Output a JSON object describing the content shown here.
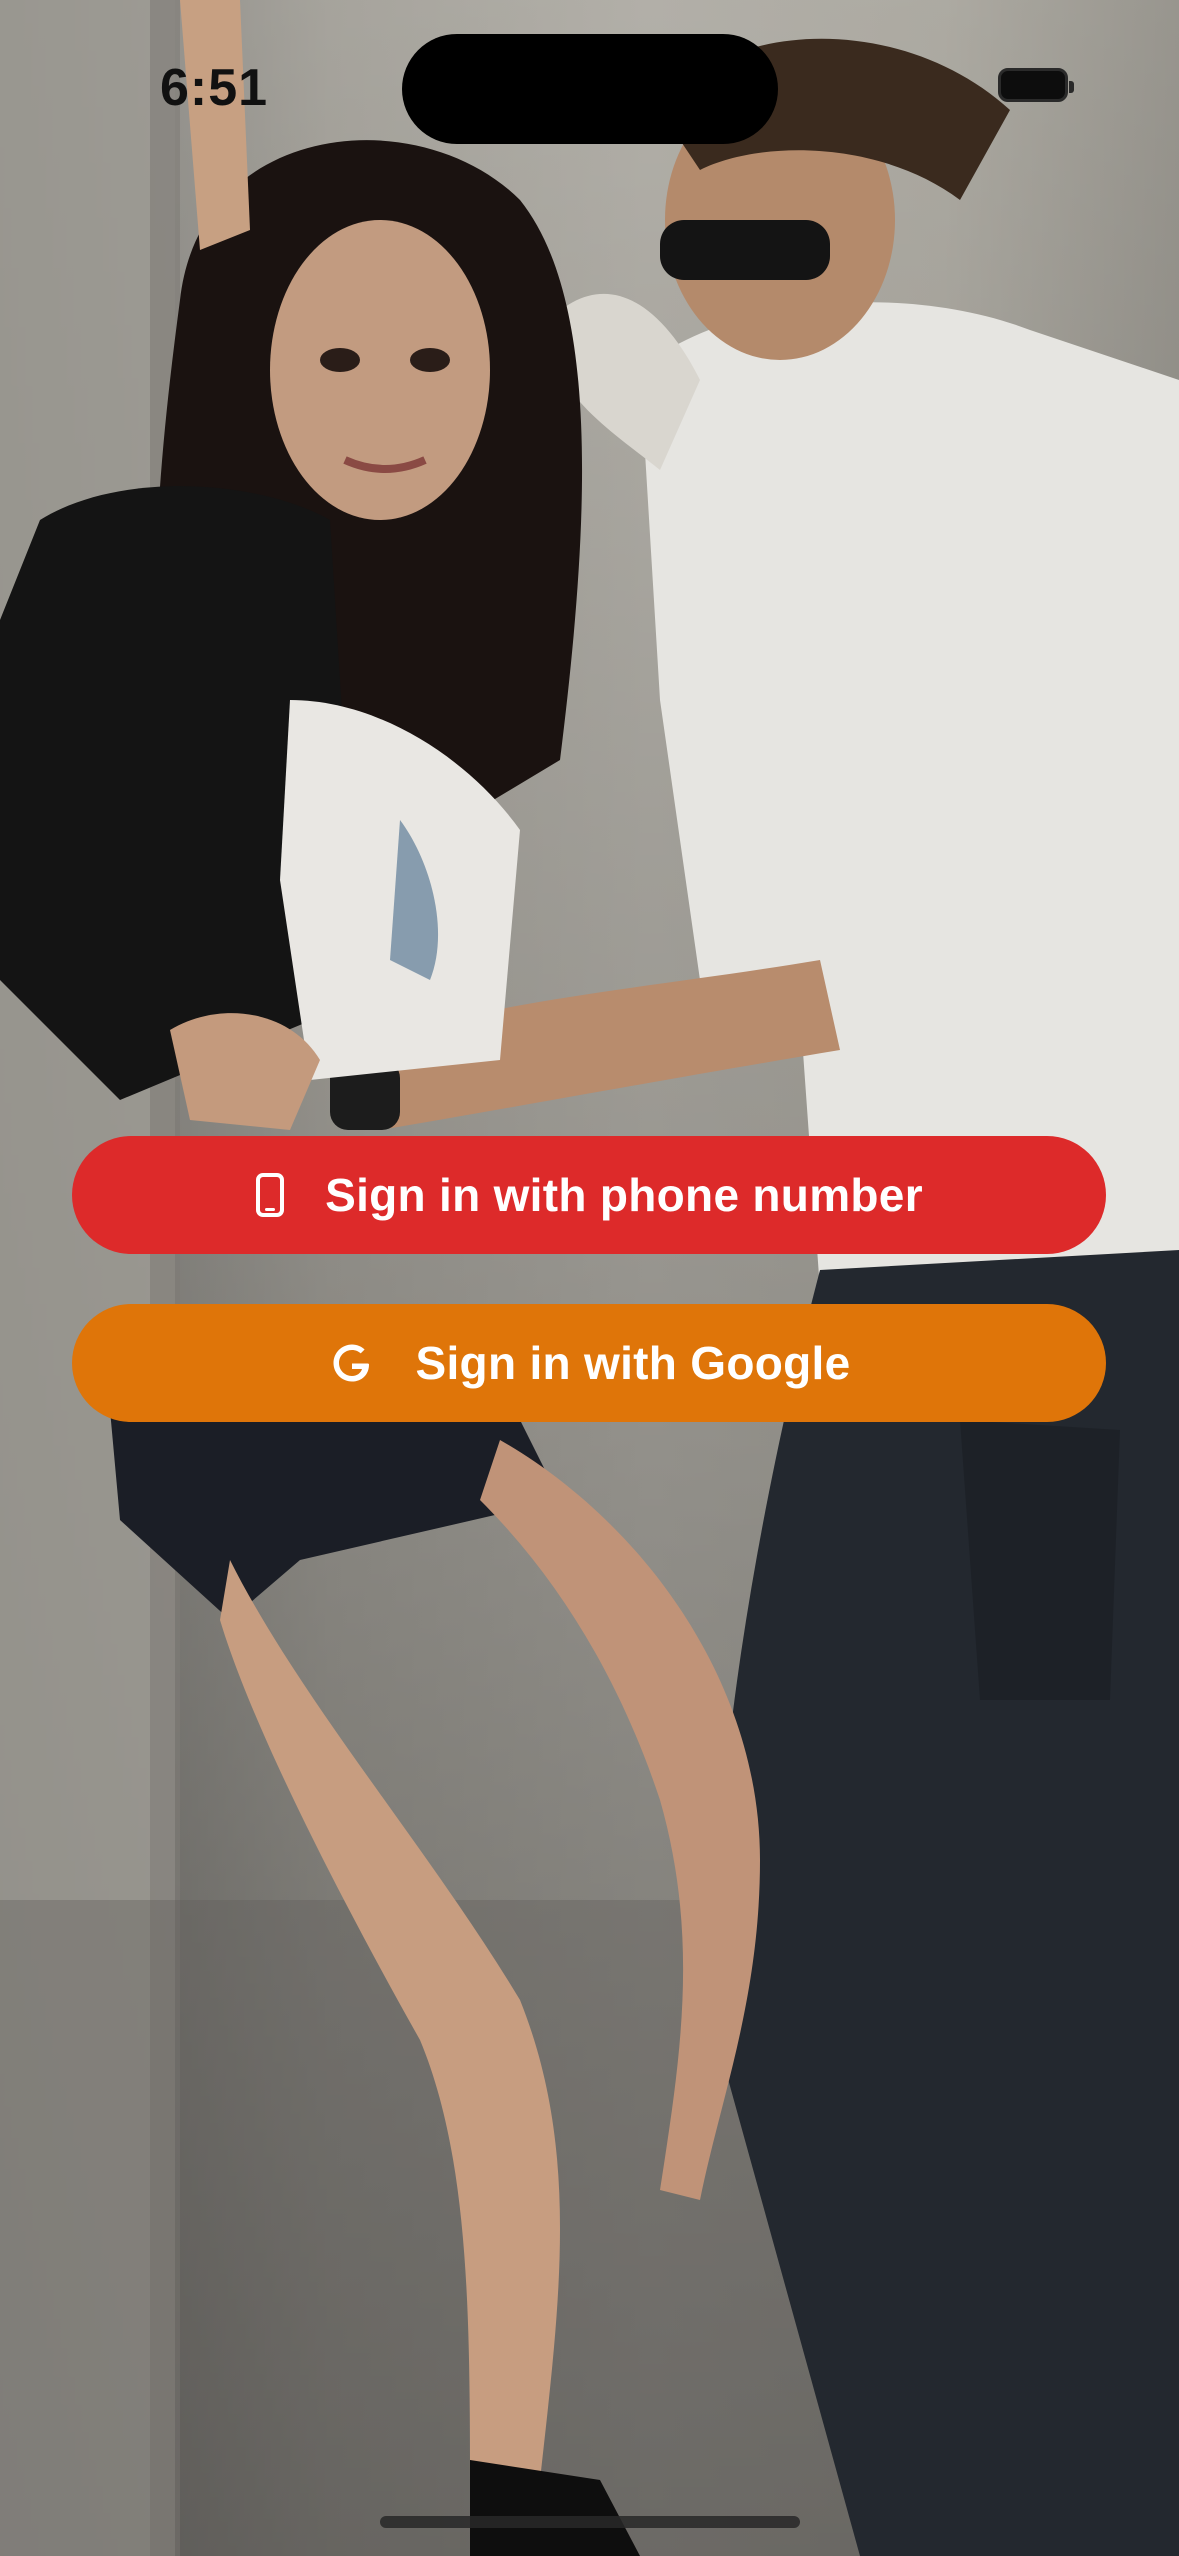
{
  "status_bar": {
    "time": "6:51"
  },
  "background": {
    "description_icon": "photo-background"
  },
  "buttons": {
    "phone": {
      "label": "Sign in with phone number",
      "icon": "phone-icon",
      "color": "#dd2a2a"
    },
    "google": {
      "label": "Sign in with Google",
      "icon": "google-icon",
      "color": "#df7509"
    }
  }
}
